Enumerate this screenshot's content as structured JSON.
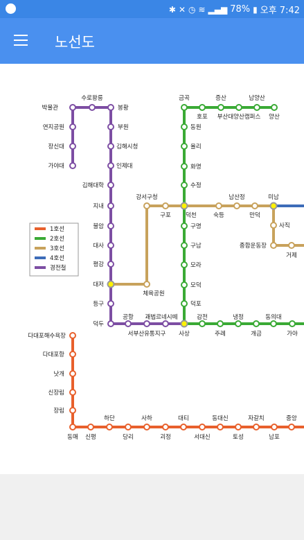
{
  "status": {
    "battery": "78%",
    "time": "오후 7:42"
  },
  "toolbar": {
    "title": "노선도"
  },
  "legend": [
    {
      "label": "1호선",
      "color": "#e8602c"
    },
    {
      "label": "2호선",
      "color": "#3aaa35"
    },
    {
      "label": "3호선",
      "color": "#c8a25c"
    },
    {
      "label": "4호선",
      "color": "#3d6cb9"
    },
    {
      "label": "경전철",
      "color": "#7d4ea3"
    }
  ],
  "stations": [
    {
      "id": "s1",
      "name": "박물관"
    },
    {
      "id": "s2",
      "name": "수로왕릉"
    },
    {
      "id": "s3",
      "name": "봉황"
    },
    {
      "id": "s4",
      "name": "연지공원"
    },
    {
      "id": "s5",
      "name": "부원"
    },
    {
      "id": "s6",
      "name": "장신대"
    },
    {
      "id": "s7",
      "name": "김해시청"
    },
    {
      "id": "s8",
      "name": "가야대"
    },
    {
      "id": "s9",
      "name": "인제대"
    },
    {
      "id": "s10",
      "name": "김해대학"
    },
    {
      "id": "s11",
      "name": "지내"
    },
    {
      "id": "s12",
      "name": "불암"
    },
    {
      "id": "s13",
      "name": "대사"
    },
    {
      "id": "s14",
      "name": "평강"
    },
    {
      "id": "s15",
      "name": "대저"
    },
    {
      "id": "s16",
      "name": "등구"
    },
    {
      "id": "s17",
      "name": "덕두"
    },
    {
      "id": "s18",
      "name": "공항"
    },
    {
      "id": "s19",
      "name": "서부산유통지구"
    },
    {
      "id": "s20",
      "name": "괘법르네시떼"
    },
    {
      "id": "s21",
      "name": "사상"
    },
    {
      "id": "s22",
      "name": "강서구청"
    },
    {
      "id": "s23",
      "name": "구포"
    },
    {
      "id": "s24",
      "name": "체육공원"
    },
    {
      "id": "s25",
      "name": "덕천"
    },
    {
      "id": "s26",
      "name": "숙등"
    },
    {
      "id": "s27",
      "name": "남산정"
    },
    {
      "id": "s28",
      "name": "만덕"
    },
    {
      "id": "s29",
      "name": "미남"
    },
    {
      "id": "s30",
      "name": "사직"
    },
    {
      "id": "s31",
      "name": "종합운동장"
    },
    {
      "id": "s32",
      "name": "거제"
    },
    {
      "id": "s33",
      "name": "금곡"
    },
    {
      "id": "s34",
      "name": "호포"
    },
    {
      "id": "s35",
      "name": "증산"
    },
    {
      "id": "s36",
      "name": "부산대양산캠퍼스"
    },
    {
      "id": "s37",
      "name": "남양산"
    },
    {
      "id": "s38",
      "name": "양산"
    },
    {
      "id": "s39",
      "name": "동원"
    },
    {
      "id": "s40",
      "name": "율리"
    },
    {
      "id": "s41",
      "name": "화명"
    },
    {
      "id": "s42",
      "name": "수정"
    },
    {
      "id": "s43",
      "name": "구명"
    },
    {
      "id": "s44",
      "name": "구남"
    },
    {
      "id": "s45",
      "name": "모라"
    },
    {
      "id": "s46",
      "name": "모덕"
    },
    {
      "id": "s47",
      "name": "덕포"
    },
    {
      "id": "s48",
      "name": "감전"
    },
    {
      "id": "s49",
      "name": "주례"
    },
    {
      "id": "s50",
      "name": "냉정"
    },
    {
      "id": "s51",
      "name": "개금"
    },
    {
      "id": "s52",
      "name": "동의대"
    },
    {
      "id": "s53",
      "name": "가야"
    },
    {
      "id": "s54",
      "name": "다대포해수욕장"
    },
    {
      "id": "s55",
      "name": "다대포항"
    },
    {
      "id": "s56",
      "name": "낫개"
    },
    {
      "id": "s57",
      "name": "신장림"
    },
    {
      "id": "s58",
      "name": "장림"
    },
    {
      "id": "s59",
      "name": "동매"
    },
    {
      "id": "s60",
      "name": "신평"
    },
    {
      "id": "s61",
      "name": "하단"
    },
    {
      "id": "s62",
      "name": "당리"
    },
    {
      "id": "s63",
      "name": "사하"
    },
    {
      "id": "s64",
      "name": "괴정"
    },
    {
      "id": "s65",
      "name": "대티"
    },
    {
      "id": "s66",
      "name": "서대신"
    },
    {
      "id": "s67",
      "name": "동대신"
    },
    {
      "id": "s68",
      "name": "토성"
    },
    {
      "id": "s69",
      "name": "자갈치"
    },
    {
      "id": "s70",
      "name": "남포"
    },
    {
      "id": "s71",
      "name": "중앙"
    }
  ]
}
